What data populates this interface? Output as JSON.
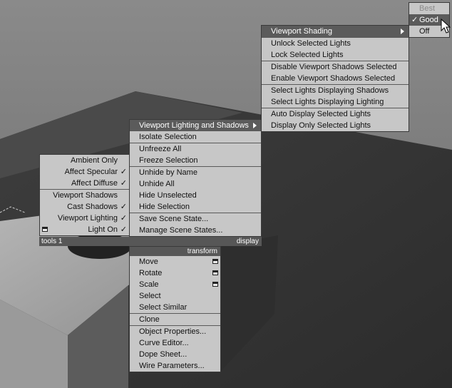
{
  "top_submenu": {
    "items": [
      {
        "label": "Best",
        "disabled": true
      },
      {
        "label": "Good",
        "checked": true
      },
      {
        "label": "Off"
      }
    ]
  },
  "viewport_menu": {
    "items": [
      {
        "label": "Viewport Shading",
        "submenu": true,
        "highlighted": true
      },
      {
        "label": "Unlock Selected Lights"
      },
      {
        "label": "Lock Selected Lights"
      },
      {
        "label": "Disable Viewport Shadows Selected"
      },
      {
        "label": "Enable Viewport Shadows Selected"
      },
      {
        "label": "Select Lights Displaying Shadows"
      },
      {
        "label": "Select Lights Displaying Lighting"
      },
      {
        "label": "Auto Display Selected Lights"
      },
      {
        "label": "Display Only Selected Lights"
      }
    ]
  },
  "display_menu": {
    "items": [
      {
        "label": "Viewport Lighting and Shadows",
        "submenu": true,
        "highlighted": true
      },
      {
        "label": "Isolate Selection"
      },
      {
        "label": "Unfreeze All"
      },
      {
        "label": "Freeze Selection"
      },
      {
        "label": "Unhide by Name"
      },
      {
        "label": "Unhide All"
      },
      {
        "label": "Hide Unselected"
      },
      {
        "label": "Hide Selection"
      },
      {
        "label": "Save Scene State..."
      },
      {
        "label": "Manage Scene States..."
      }
    ]
  },
  "tools_menu": {
    "items": [
      {
        "label": "Ambient Only"
      },
      {
        "label": "Affect Specular",
        "checked": true
      },
      {
        "label": "Affect Diffuse",
        "checked": true
      },
      {
        "label": "Viewport Shadows"
      },
      {
        "label": "Cast Shadows",
        "checked": true
      },
      {
        "label": "Viewport Lighting",
        "checked": true
      },
      {
        "label": "Light On",
        "checked": true
      }
    ]
  },
  "quad_labels": {
    "tools": "tools 1",
    "display": "display",
    "transform": "transform"
  },
  "transform_menu": {
    "items": [
      {
        "label": "Move"
      },
      {
        "label": "Rotate"
      },
      {
        "label": "Scale"
      },
      {
        "label": "Select"
      },
      {
        "label": "Select Similar"
      },
      {
        "label": "Clone"
      },
      {
        "label": "Object Properties..."
      },
      {
        "label": "Curve Editor..."
      },
      {
        "label": "Dope Sheet..."
      },
      {
        "label": "Wire Parameters..."
      }
    ]
  },
  "check_glyph": "✓"
}
